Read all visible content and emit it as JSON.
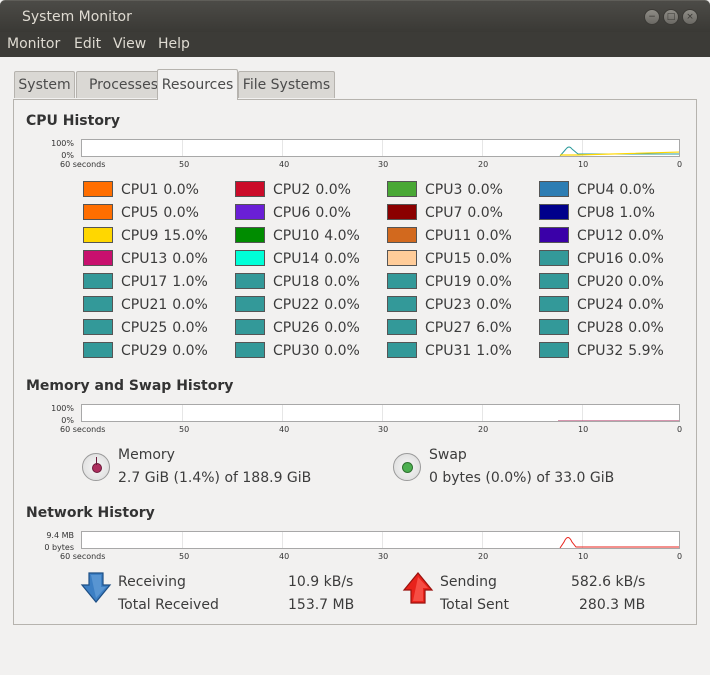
{
  "window": {
    "title": "System Monitor"
  },
  "menu": [
    "Monitor",
    "Edit",
    "View",
    "Help"
  ],
  "tabs": [
    {
      "label": "System",
      "active": false
    },
    {
      "label": "Processes",
      "active": false
    },
    {
      "label": "Resources",
      "active": true
    },
    {
      "label": "File Systems",
      "active": false
    }
  ],
  "x_ticks": [
    "60 seconds",
    "50",
    "40",
    "30",
    "20",
    "10",
    "0"
  ],
  "cpu": {
    "title": "CPU History",
    "y_max": "100%",
    "y_min": "0%",
    "items": [
      {
        "name": "CPU1",
        "value": "0.0%",
        "color": "#ff6e00"
      },
      {
        "name": "CPU2",
        "value": "0.0%",
        "color": "#cb0c29"
      },
      {
        "name": "CPU3",
        "value": "0.0%",
        "color": "#49a835"
      },
      {
        "name": "CPU4",
        "value": "0.0%",
        "color": "#2d7db3"
      },
      {
        "name": "CPU5",
        "value": "0.0%",
        "color": "#ff6e00"
      },
      {
        "name": "CPU6",
        "value": "0.0%",
        "color": "#6a1fd6"
      },
      {
        "name": "CPU7",
        "value": "0.0%",
        "color": "#8b0000"
      },
      {
        "name": "CPU8",
        "value": "1.0%",
        "color": "#00008b"
      },
      {
        "name": "CPU9",
        "value": "15.0%",
        "color": "#ffd700"
      },
      {
        "name": "CPU10",
        "value": "4.0%",
        "color": "#008c00"
      },
      {
        "name": "CPU11",
        "value": "0.0%",
        "color": "#d2691e"
      },
      {
        "name": "CPU12",
        "value": "0.0%",
        "color": "#3a00a8"
      },
      {
        "name": "CPU13",
        "value": "0.0%",
        "color": "#c8106e"
      },
      {
        "name": "CPU14",
        "value": "0.0%",
        "color": "#00ffd8"
      },
      {
        "name": "CPU15",
        "value": "0.0%",
        "color": "#ffcc99"
      },
      {
        "name": "CPU16",
        "value": "0.0%",
        "color": "#339999"
      },
      {
        "name": "CPU17",
        "value": "1.0%",
        "color": "#339999"
      },
      {
        "name": "CPU18",
        "value": "0.0%",
        "color": "#339999"
      },
      {
        "name": "CPU19",
        "value": "0.0%",
        "color": "#339999"
      },
      {
        "name": "CPU20",
        "value": "0.0%",
        "color": "#339999"
      },
      {
        "name": "CPU21",
        "value": "0.0%",
        "color": "#339999"
      },
      {
        "name": "CPU22",
        "value": "0.0%",
        "color": "#339999"
      },
      {
        "name": "CPU23",
        "value": "0.0%",
        "color": "#339999"
      },
      {
        "name": "CPU24",
        "value": "0.0%",
        "color": "#339999"
      },
      {
        "name": "CPU25",
        "value": "0.0%",
        "color": "#339999"
      },
      {
        "name": "CPU26",
        "value": "0.0%",
        "color": "#339999"
      },
      {
        "name": "CPU27",
        "value": "6.0%",
        "color": "#339999"
      },
      {
        "name": "CPU28",
        "value": "0.0%",
        "color": "#339999"
      },
      {
        "name": "CPU29",
        "value": "0.0%",
        "color": "#339999"
      },
      {
        "name": "CPU30",
        "value": "0.0%",
        "color": "#339999"
      },
      {
        "name": "CPU31",
        "value": "1.0%",
        "color": "#339999"
      },
      {
        "name": "CPU32",
        "value": "5.9%",
        "color": "#339999"
      }
    ]
  },
  "memory": {
    "title": "Memory and Swap History",
    "y_max": "100%",
    "y_min": "0%",
    "memory_label": "Memory",
    "memory_value": "2.7 GiB (1.4%) of 188.9 GiB",
    "memory_color": "#ad2e5e",
    "swap_label": "Swap",
    "swap_value": "0 bytes (0.0%) of 33.0 GiB",
    "swap_color": "#4caf50"
  },
  "network": {
    "title": "Network History",
    "y_max": "9.4 MB",
    "y_min": "0 bytes",
    "receiving_label": "Receiving",
    "receiving_value": "10.9 kB/s",
    "total_received_label": "Total Received",
    "total_received_value": "153.7 MB",
    "sending_label": "Sending",
    "sending_value": "582.6 kB/s",
    "total_sent_label": "Total Sent",
    "total_sent_value": "280.3 MB",
    "receiving_color": "#3c7fc4",
    "sending_color": "#e8221b"
  }
}
